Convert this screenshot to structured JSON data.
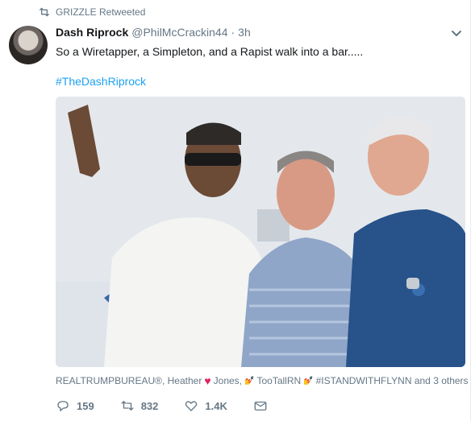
{
  "retweet": {
    "icon": "retweet-icon",
    "text": "GRIZZLE Retweeted"
  },
  "tweet": {
    "author_name": "Dash Riprock",
    "author_handle": "@PhilMcCrackin44",
    "separator": "·",
    "time": "3h",
    "text": "So a Wiretapper, a Simpleton, and a Rapist walk into a bar.....",
    "hashtag": "#TheDashRiprock",
    "menu_icon": "chevron-down-icon"
  },
  "photo": {
    "description_icon": "photo"
  },
  "likers": {
    "part1": "REALTRUMPBUREAU®, Heather",
    "heart": "♥",
    "part2": "Jones,",
    "emoji1": "💅",
    "part3": "TooTallRN",
    "emoji2": "💅",
    "part4": "#ISTANDWITHFLYNN and 3 others"
  },
  "actions": {
    "reply_count": "159",
    "retweet_count": "832",
    "like_count": "1.4K",
    "reply_icon": "reply-icon",
    "retweet_icon": "retweet-icon",
    "like_icon": "heart-icon",
    "dm_icon": "mail-icon"
  },
  "colors": {
    "link": "#1da1f2",
    "muted": "#657786",
    "heart": "#e0245e"
  }
}
